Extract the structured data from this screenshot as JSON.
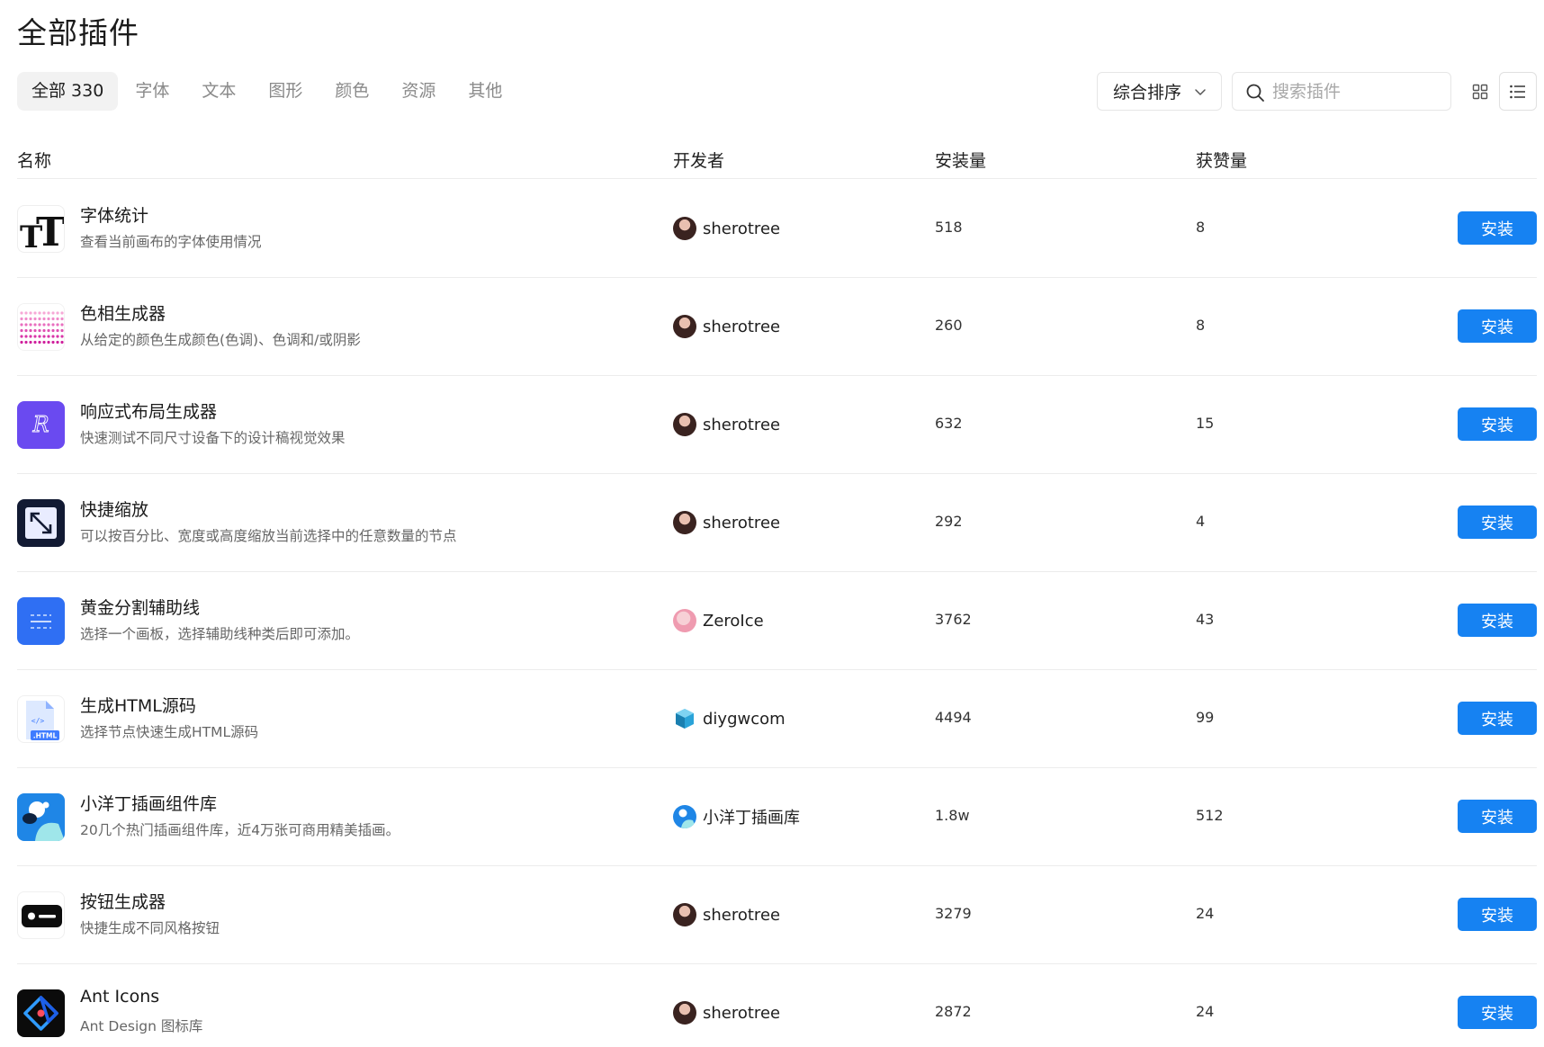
{
  "page_title": "全部插件",
  "tabs": [
    {
      "label": "全部 330",
      "active": true
    },
    {
      "label": "字体",
      "active": false
    },
    {
      "label": "文本",
      "active": false
    },
    {
      "label": "图形",
      "active": false
    },
    {
      "label": "颜色",
      "active": false
    },
    {
      "label": "资源",
      "active": false
    },
    {
      "label": "其他",
      "active": false
    }
  ],
  "sort": {
    "label": "综合排序"
  },
  "search": {
    "placeholder": "搜索插件",
    "value": ""
  },
  "view_modes": {
    "grid": "grid-view-icon",
    "list": "list-view-icon",
    "active": "list"
  },
  "columns": {
    "name": "名称",
    "developer": "开发者",
    "installs": "安装量",
    "likes": "获赞量"
  },
  "accent_color": "#1682f2",
  "plugins": [
    {
      "name": "字体统计",
      "desc": "查看当前画布的字体使用情况",
      "developer": "sherotree",
      "installs": "518",
      "likes": "8",
      "button": "安装",
      "icon": "font-stats-icon"
    },
    {
      "name": "色相生成器",
      "desc": "从给定的颜色生成颜色(色调)、色调和/或阴影",
      "developer": "sherotree",
      "installs": "260",
      "likes": "8",
      "button": "安装",
      "icon": "hue-generator-icon"
    },
    {
      "name": "响应式布局生成器",
      "desc": "快速测试不同尺寸设备下的设计稿视觉效果",
      "developer": "sherotree",
      "installs": "632",
      "likes": "15",
      "button": "安装",
      "icon": "responsive-layout-icon"
    },
    {
      "name": "快捷缩放",
      "desc": "可以按百分比、宽度或高度缩放当前选择中的任意数量的节点",
      "developer": "sherotree",
      "installs": "292",
      "likes": "4",
      "button": "安装",
      "icon": "quick-scale-icon"
    },
    {
      "name": "黄金分割辅助线",
      "desc": "选择一个画板，选择辅助线种类后即可添加。",
      "developer": "ZeroIce",
      "installs": "3762",
      "likes": "43",
      "button": "安装",
      "icon": "golden-ratio-guides-icon"
    },
    {
      "name": "生成HTML源码",
      "desc": "选择节点快速生成HTML源码",
      "developer": "diygwcom",
      "installs": "4494",
      "likes": "99",
      "button": "安装",
      "icon": "html-file-icon"
    },
    {
      "name": "小洋丁插画组件库",
      "desc": "20几个热门插画组件库，近4万张可商用精美插画。",
      "developer": "小洋丁插画库",
      "installs": "1.8w",
      "likes": "512",
      "button": "安装",
      "icon": "illustration-library-icon"
    },
    {
      "name": "按钮生成器",
      "desc": "快捷生成不同风格按钮",
      "developer": "sherotree",
      "installs": "3279",
      "likes": "24",
      "button": "安装",
      "icon": "button-generator-icon"
    },
    {
      "name": "Ant Icons",
      "desc": "Ant Design 图标库",
      "developer": "sherotree",
      "installs": "2872",
      "likes": "24",
      "button": "安装",
      "icon": "ant-design-icon"
    }
  ]
}
